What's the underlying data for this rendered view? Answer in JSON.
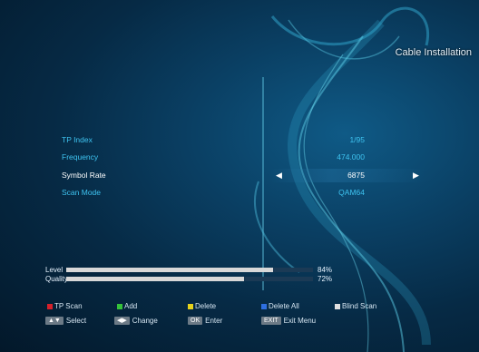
{
  "header": {
    "title": "Cable Installation"
  },
  "fields": [
    {
      "label": "TP Index",
      "value": "1/95",
      "selected": false
    },
    {
      "label": "Frequency",
      "value": "474.000",
      "selected": false
    },
    {
      "label": "Symbol Rate",
      "value": "6875",
      "selected": true
    },
    {
      "label": "Scan Mode",
      "value": "QAM64",
      "selected": false
    }
  ],
  "signal": {
    "level": {
      "label": "Level",
      "text": "84%",
      "value": 84
    },
    "quality": {
      "label": "Quality",
      "text": "72%",
      "value": 72
    }
  },
  "color_keys": [
    {
      "label": "TP Scan",
      "color": "#d6202a"
    },
    {
      "label": "Add",
      "color": "#35c23a"
    },
    {
      "label": "Delete",
      "color": "#e6d21c"
    },
    {
      "label": "Delete All",
      "color": "#2e6fe0"
    },
    {
      "label": "Blind Scan",
      "color": "#e0e0e0"
    }
  ],
  "nav_hints": [
    {
      "key": "▲▼",
      "label": "Select"
    },
    {
      "key": "◀▶",
      "label": "Change"
    },
    {
      "key": "OK",
      "label": "Enter"
    },
    {
      "key": "EXIT",
      "label": "Exit Menu"
    }
  ]
}
